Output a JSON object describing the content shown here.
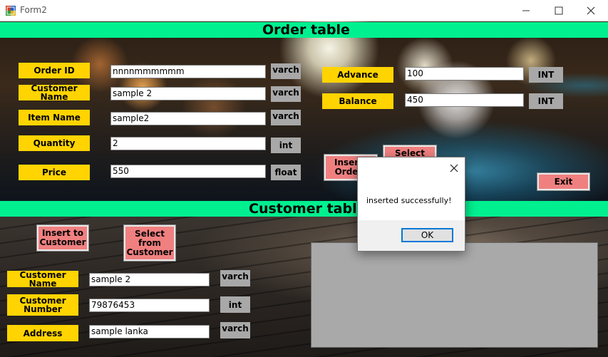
{
  "window": {
    "title": "Form2"
  },
  "order_section": {
    "title": "Order table",
    "fields": [
      {
        "label": "Order ID",
        "value": "nnnnmmmmmm",
        "type": "varch"
      },
      {
        "label": "Customer Name",
        "value": "sample 2",
        "type": "varch"
      },
      {
        "label": "Item Name",
        "value": "sample2",
        "type": "varch"
      },
      {
        "label": "Quantity",
        "value": "2",
        "type": "int"
      },
      {
        "label": "Price",
        "value": "550",
        "type": "float"
      }
    ],
    "right_fields": [
      {
        "label": "Advance",
        "value": "100",
        "type": "INT"
      },
      {
        "label": "Balance",
        "value": "450",
        "type": "INT"
      }
    ],
    "insert_button": "Insert\nOrder",
    "select_button": "Select",
    "exit_button": "Exit"
  },
  "customer_section": {
    "title": "Customer table",
    "insert_button": "Insert to\nCustomer",
    "select_button": "Select\nfrom\nCustomer",
    "fields": [
      {
        "label": "Customer Name",
        "value": "sample 2",
        "type": "varch"
      },
      {
        "label": "Customer\nNumber",
        "value": "79876453",
        "type": "int"
      },
      {
        "label": "Address",
        "value": "sample lanka",
        "type": "varch"
      }
    ]
  },
  "dialog": {
    "message": "inserted successfully!",
    "ok_label": "OK"
  },
  "colors": {
    "banner": "#00f08f",
    "label": "#ffd400",
    "button": "#f08080",
    "type_tag": "#a8a8a8"
  }
}
